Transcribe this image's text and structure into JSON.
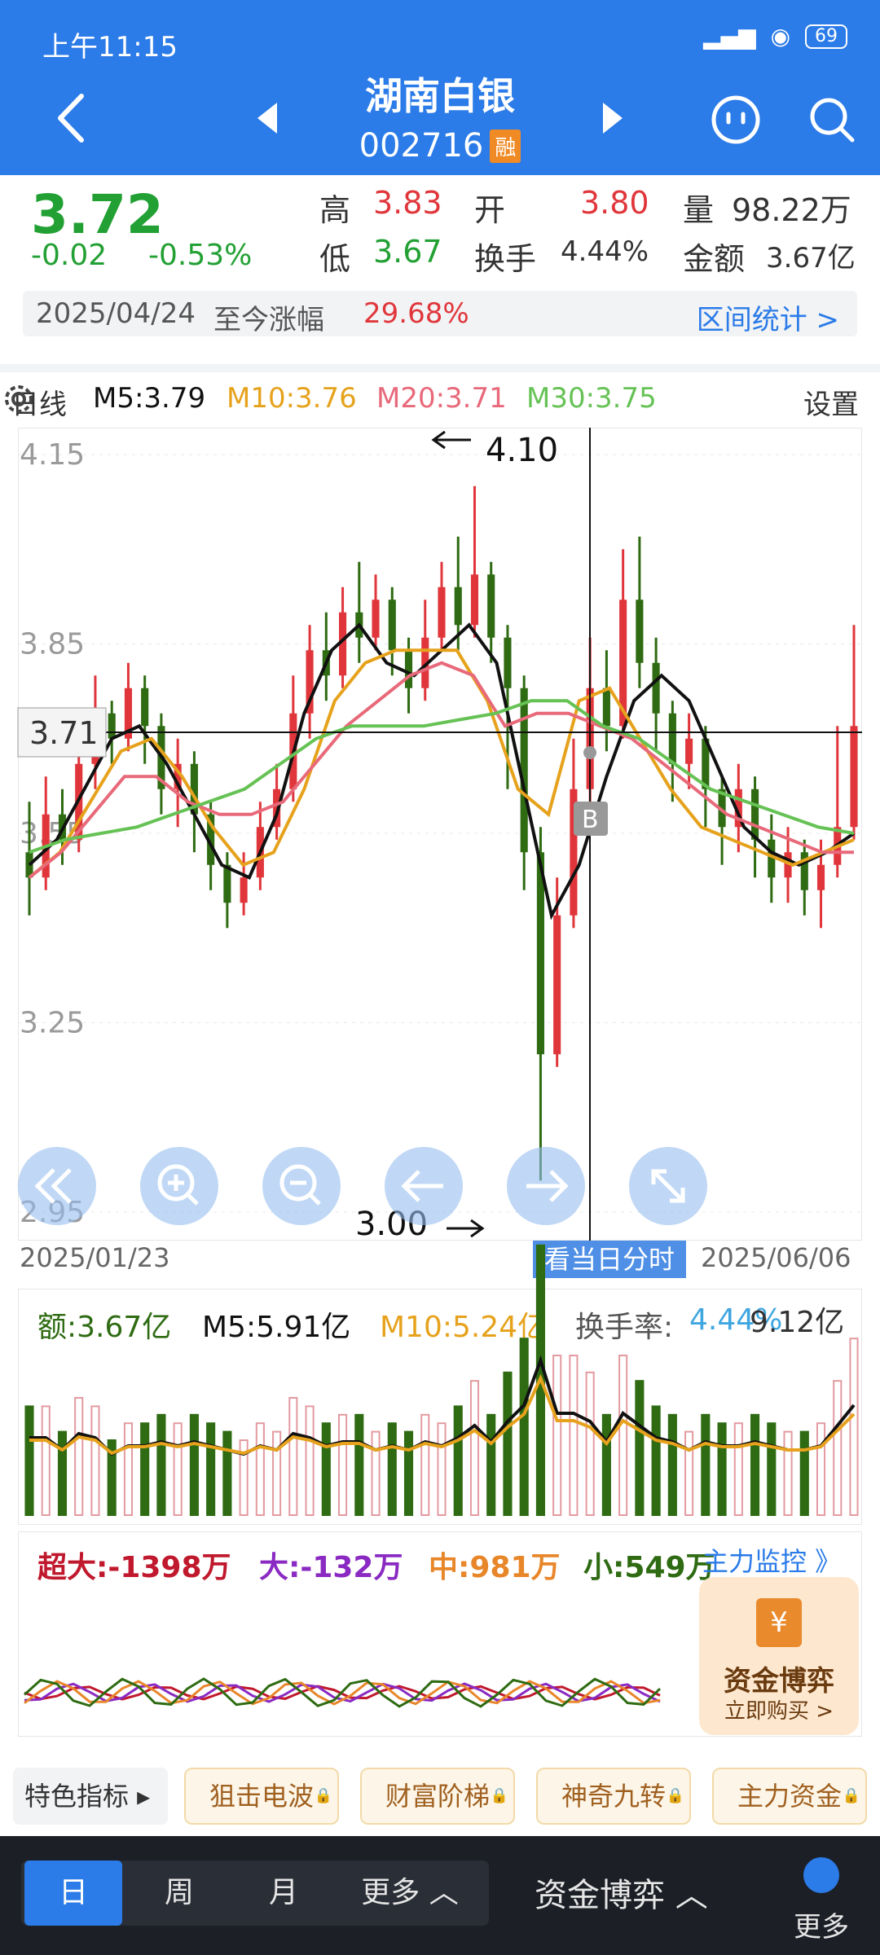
{
  "status_bar": {
    "time": "上午11:15",
    "battery": "69"
  },
  "header": {
    "stock_name": "湖南白银",
    "stock_code": "002716",
    "margin_badge": "融"
  },
  "quote": {
    "price": "3.72",
    "change": "-0.02",
    "change_pct": "-0.53%",
    "high_label": "高",
    "high": "3.83",
    "low_label": "低",
    "low": "3.67",
    "open_label": "开",
    "open": "3.80",
    "turnover_label": "换手",
    "turnover": "4.44%",
    "volume_label": "量",
    "volume": "98.22万",
    "amount_label": "金额",
    "amount": "3.67亿",
    "range_date": "2025/04/24",
    "range_label": "至今涨幅",
    "range_gain": "29.68%",
    "range_link": "区间统计 >"
  },
  "ma_legend": {
    "period": "日线",
    "m5": "M5:3.79",
    "m10": "M10:3.76",
    "m20": "M20:3.71",
    "m30": "M30:3.75",
    "settings": "设置"
  },
  "colors": {
    "up": "#e0363b",
    "down": "#2e6b12",
    "m5": "#111111",
    "m10": "#e6a21c",
    "m20": "#e8697a",
    "m30": "#66c255",
    "accent": "#2b7be8"
  },
  "kline": {
    "y_ticks": [
      "4.15",
      "3.85",
      "3.55",
      "3.25",
      "2.95"
    ],
    "crosshair_price": "3.71",
    "max_annotation": "4.10",
    "min_annotation": "3.00",
    "marker_b": "B",
    "start_date": "2025/01/23",
    "end_date": "2025/06/06",
    "intraday_button": "看当日分时"
  },
  "volume_panel": {
    "amount": "额:3.67亿",
    "m5": "M5:5.91亿",
    "m10": "M10:5.24亿",
    "turnover_label": "换手率:",
    "turnover": "4.44%",
    "max_label": "9.12亿"
  },
  "flow_panel": {
    "super_large": "超大:-1398万",
    "large": "大:-132万",
    "medium": "中:981万",
    "small": "小:549万",
    "monitor_link": "主力监控 》",
    "promo_icon": "¥",
    "promo_title": "资金博弈",
    "promo_sub": "立即购买 >"
  },
  "indicators": {
    "label": "特色指标 ▸",
    "chips": [
      "狙击电波",
      "财富阶梯",
      "神奇九转",
      "主力资金"
    ]
  },
  "bottom_bar": {
    "tabs": [
      "日",
      "周",
      "月",
      "更多 ︿"
    ],
    "game": "资金博弈 ︿",
    "more": "更多"
  },
  "chart_data": {
    "type": "candlestick",
    "y_ticks": [
      4.15,
      3.85,
      3.55,
      3.25,
      2.95
    ],
    "ylim": [
      2.95,
      4.15
    ],
    "x_range": [
      "2025/01/23",
      "2025/06/06"
    ],
    "candles": [
      [
        3.52,
        3.48,
        3.6,
        3.42
      ],
      [
        3.48,
        3.58,
        3.64,
        3.46
      ],
      [
        3.58,
        3.54,
        3.62,
        3.5
      ],
      [
        3.54,
        3.66,
        3.72,
        3.52
      ],
      [
        3.66,
        3.74,
        3.8,
        3.62
      ],
      [
        3.74,
        3.7,
        3.76,
        3.66
      ],
      [
        3.7,
        3.78,
        3.82,
        3.68
      ],
      [
        3.78,
        3.72,
        3.8,
        3.66
      ],
      [
        3.72,
        3.62,
        3.74,
        3.58
      ],
      [
        3.62,
        3.66,
        3.7,
        3.56
      ],
      [
        3.66,
        3.58,
        3.68,
        3.52
      ],
      [
        3.58,
        3.5,
        3.6,
        3.46
      ],
      [
        3.5,
        3.44,
        3.52,
        3.4
      ],
      [
        3.44,
        3.48,
        3.52,
        3.42
      ],
      [
        3.48,
        3.56,
        3.6,
        3.46
      ],
      [
        3.56,
        3.62,
        3.66,
        3.54
      ],
      [
        3.62,
        3.74,
        3.8,
        3.6
      ],
      [
        3.74,
        3.84,
        3.88,
        3.7
      ],
      [
        3.84,
        3.8,
        3.9,
        3.76
      ],
      [
        3.8,
        3.9,
        3.94,
        3.78
      ],
      [
        3.9,
        3.86,
        3.98,
        3.82
      ],
      [
        3.86,
        3.92,
        3.96,
        3.84
      ],
      [
        3.92,
        3.84,
        3.94,
        3.8
      ],
      [
        3.84,
        3.78,
        3.86,
        3.74
      ],
      [
        3.78,
        3.86,
        3.92,
        3.76
      ],
      [
        3.86,
        3.94,
        3.98,
        3.84
      ],
      [
        3.94,
        3.88,
        4.02,
        3.84
      ],
      [
        3.88,
        3.96,
        4.1,
        3.86
      ],
      [
        3.96,
        3.86,
        3.98,
        3.82
      ],
      [
        3.86,
        3.78,
        3.88,
        3.62
      ],
      [
        3.78,
        3.52,
        3.8,
        3.46
      ],
      [
        3.52,
        3.2,
        3.56,
        3.0
      ],
      [
        3.2,
        3.42,
        3.48,
        3.18
      ],
      [
        3.42,
        3.62,
        3.7,
        3.4
      ],
      [
        3.62,
        3.78,
        3.86,
        3.6
      ],
      [
        3.78,
        3.72,
        3.84,
        3.68
      ],
      [
        3.72,
        3.92,
        4.0,
        3.7
      ],
      [
        3.92,
        3.82,
        4.02,
        3.78
      ],
      [
        3.82,
        3.74,
        3.86,
        3.68
      ],
      [
        3.74,
        3.66,
        3.76,
        3.6
      ],
      [
        3.66,
        3.7,
        3.74,
        3.62
      ],
      [
        3.7,
        3.62,
        3.72,
        3.56
      ],
      [
        3.62,
        3.56,
        3.64,
        3.5
      ],
      [
        3.56,
        3.62,
        3.66,
        3.52
      ],
      [
        3.62,
        3.54,
        3.64,
        3.48
      ],
      [
        3.54,
        3.48,
        3.58,
        3.44
      ],
      [
        3.48,
        3.52,
        3.56,
        3.44
      ],
      [
        3.52,
        3.46,
        3.54,
        3.42
      ],
      [
        3.46,
        3.5,
        3.54,
        3.4
      ],
      [
        3.5,
        3.56,
        3.72,
        3.48
      ],
      [
        3.56,
        3.72,
        3.88,
        3.54
      ]
    ],
    "series": [
      {
        "name": "M5",
        "values": [
          3.5,
          3.54,
          3.62,
          3.7,
          3.72,
          3.66,
          3.58,
          3.5,
          3.48,
          3.58,
          3.74,
          3.84,
          3.88,
          3.82,
          3.8,
          3.84,
          3.88,
          3.82,
          3.62,
          3.42,
          3.5,
          3.64,
          3.76,
          3.8,
          3.76,
          3.66,
          3.56,
          3.52,
          3.5,
          3.52,
          3.55
        ]
      },
      {
        "name": "M10",
        "values": [
          3.48,
          3.52,
          3.6,
          3.68,
          3.7,
          3.64,
          3.56,
          3.5,
          3.52,
          3.62,
          3.76,
          3.82,
          3.84,
          3.84,
          3.84,
          3.76,
          3.62,
          3.58,
          3.76,
          3.78,
          3.7,
          3.62,
          3.56,
          3.54,
          3.52,
          3.5,
          3.52,
          3.54
        ]
      },
      {
        "name": "M20",
        "values": [
          3.48,
          3.52,
          3.58,
          3.64,
          3.64,
          3.6,
          3.58,
          3.58,
          3.6,
          3.66,
          3.72,
          3.76,
          3.8,
          3.82,
          3.8,
          3.72,
          3.74,
          3.74,
          3.72,
          3.7,
          3.66,
          3.62,
          3.58,
          3.56,
          3.54,
          3.52,
          3.52
        ]
      },
      {
        "name": "M30",
        "values": [
          3.52,
          3.54,
          3.55,
          3.56,
          3.58,
          3.6,
          3.62,
          3.66,
          3.7,
          3.72,
          3.72,
          3.72,
          3.73,
          3.74,
          3.76,
          3.76,
          3.72,
          3.7,
          3.66,
          3.62,
          3.6,
          3.58,
          3.56,
          3.55
        ]
      }
    ]
  }
}
